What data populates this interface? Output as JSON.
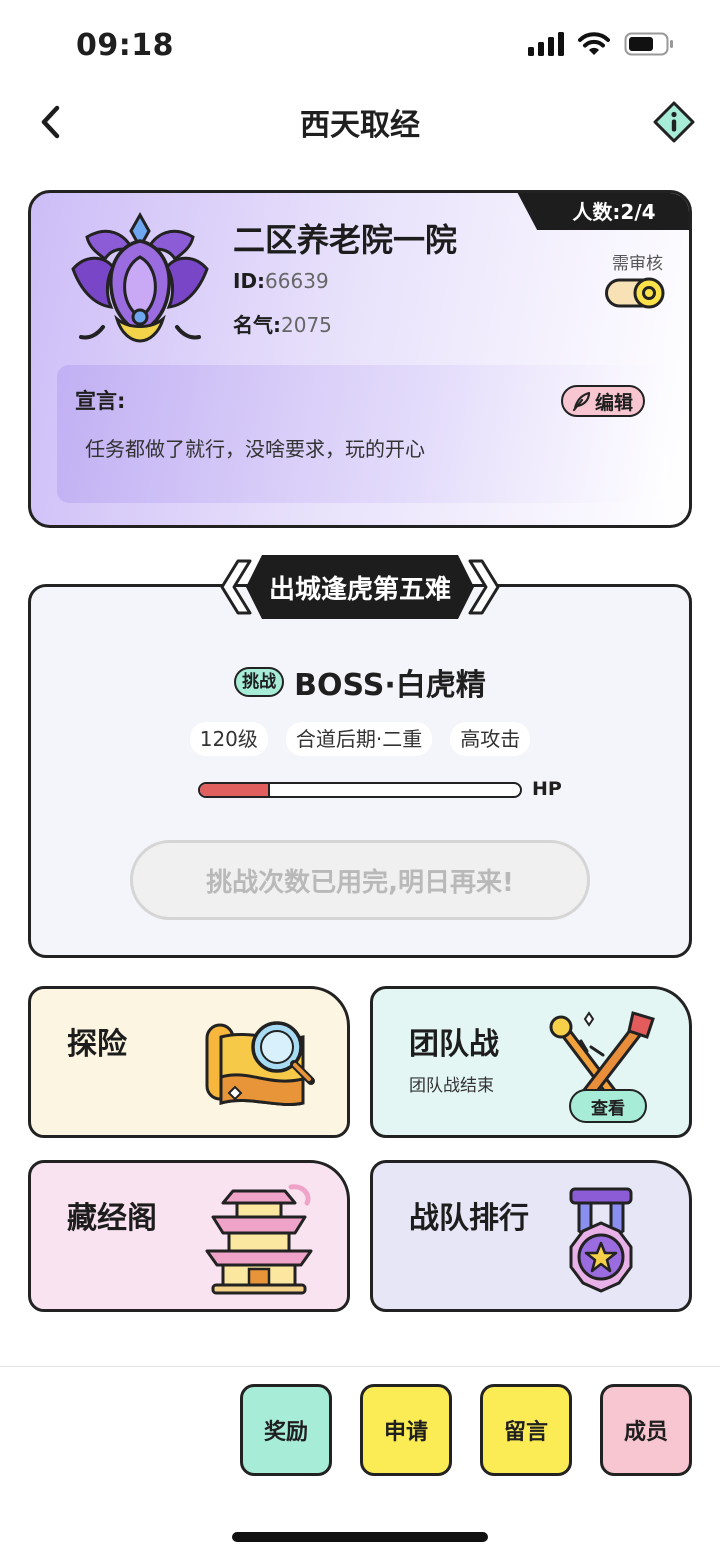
{
  "status_bar": {
    "time": "09:18"
  },
  "nav": {
    "title": "西天取经"
  },
  "team": {
    "name": "二区养老院一院",
    "id_label": "ID:",
    "id_value": "66639",
    "fame_label": "名气:",
    "fame_value": "2075",
    "member_count": "人数:2/4",
    "review_label": "需审核",
    "review_enabled": true,
    "declaration_title": "宣言:",
    "declaration_text": "任务都做了就行，没啥要求，玩的开心",
    "edit_label": "编辑"
  },
  "boss": {
    "stage_title": "出城逢虎第五难",
    "challenge_tag": "挑战",
    "name": "BOSS·白虎精",
    "tags": [
      "120级",
      "合道后期·二重",
      "高攻击"
    ],
    "hp_label": "HP",
    "hp_fraction": 0.22,
    "challenge_button": "挑战次数已用完,明日再来!"
  },
  "tiles": {
    "explore": {
      "title": "探险",
      "color": "#fcf5e2"
    },
    "team_battle": {
      "title": "团队战",
      "subtitle": "团队战结束",
      "view_label": "查看",
      "color": "#e3f6f4"
    },
    "scripture": {
      "title": "藏经阁",
      "color": "#fae3f1"
    },
    "ranking": {
      "title": "战队排行",
      "color": "#e6e6f6"
    }
  },
  "bottom_actions": [
    {
      "label": "奖励",
      "color": "#a7ecd7"
    },
    {
      "label": "申请",
      "color": "#fbec55"
    },
    {
      "label": "留言",
      "color": "#fbec55"
    },
    {
      "label": "成员",
      "color": "#f7c6d0"
    }
  ]
}
